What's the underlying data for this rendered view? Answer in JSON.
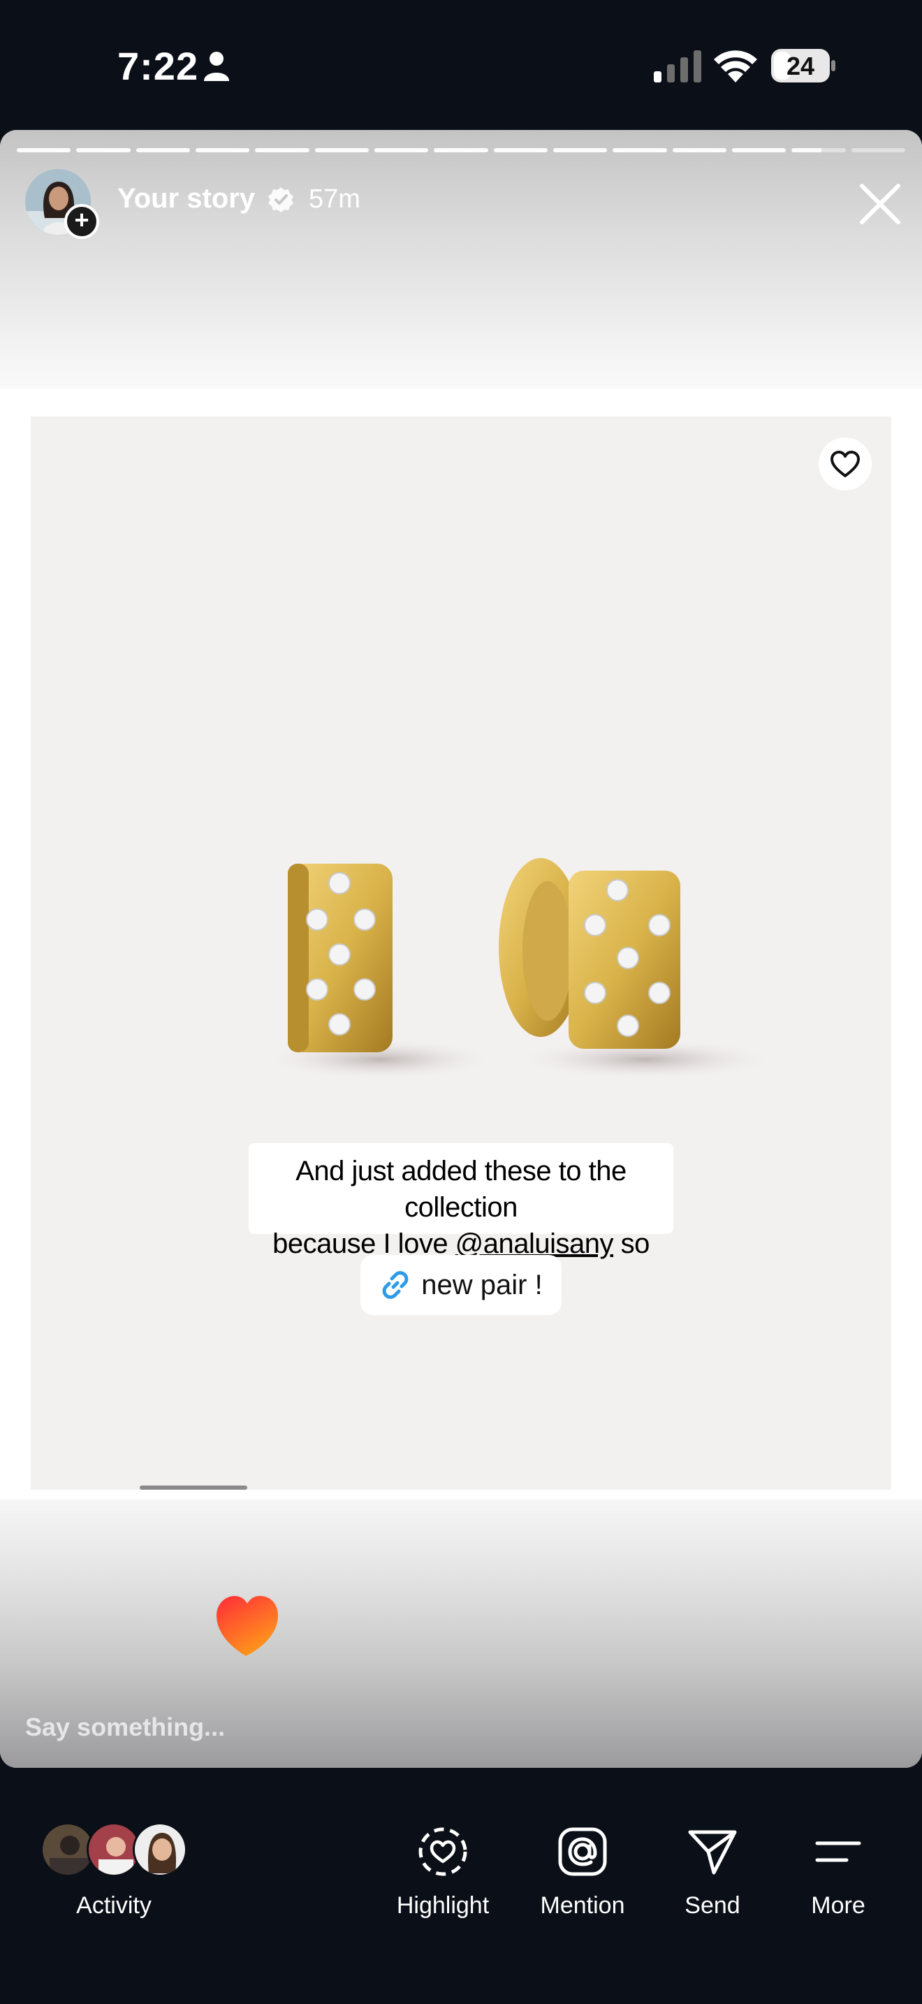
{
  "status_bar": {
    "time": "7:22",
    "battery": "24",
    "icons": [
      "person-icon",
      "cellular-signal-icon",
      "wifi-icon",
      "battery-icon"
    ]
  },
  "story": {
    "progress_segments": 15,
    "current_segment": 14,
    "current_segment_progress": 0.55,
    "name": "Your story",
    "time": "57m"
  },
  "post": {
    "caption_line1": "And just added these to the collection",
    "caption_prefix": "because I love ",
    "caption_mention": "@analuisany",
    "caption_suffix": " so much",
    "link_label": "new pair !"
  },
  "reply": {
    "placeholder": "Say something..."
  },
  "toolbar": {
    "activity": "Activity",
    "highlight": "Highlight",
    "mention": "Mention",
    "send": "Send",
    "more": "More"
  },
  "colors": {
    "background": "#0b0f17",
    "link_icon": "#2e9be8",
    "gold": "#d9b34a"
  }
}
